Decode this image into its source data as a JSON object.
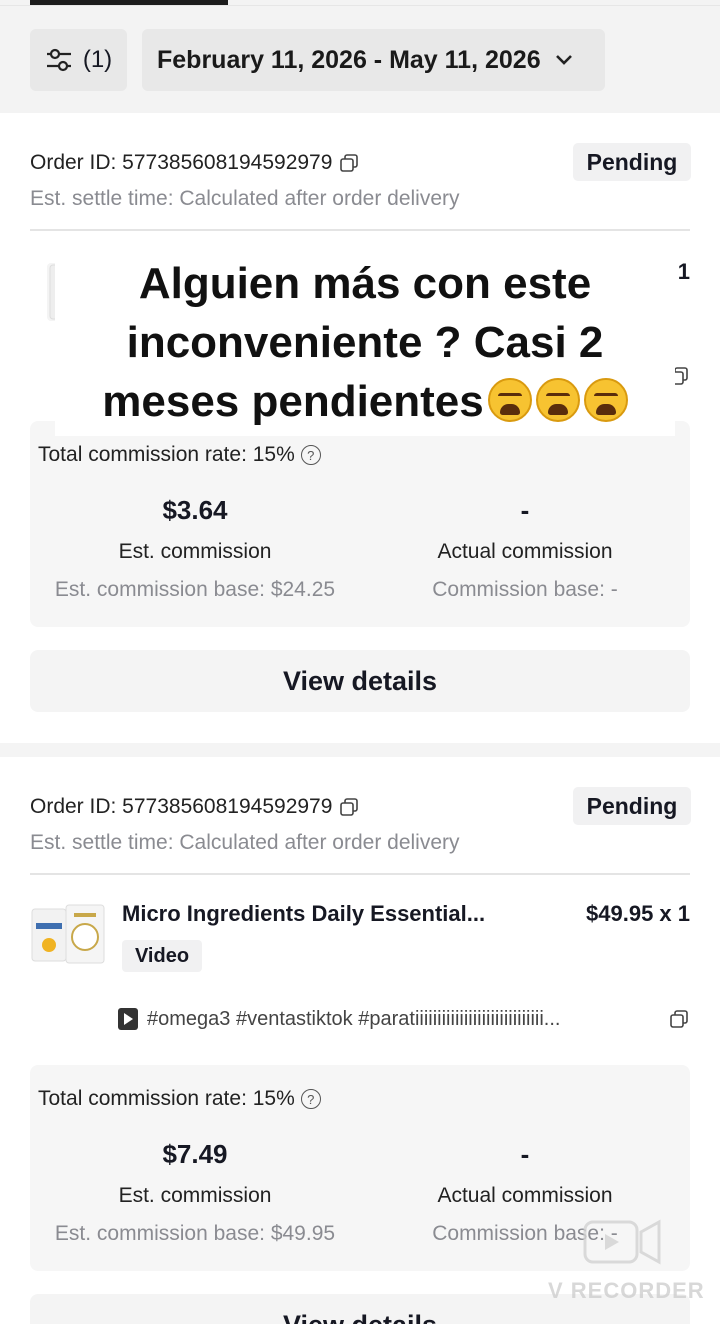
{
  "header": {
    "filter_label": "(1)",
    "date_range": "February 11, 2026 - May 11, 2026"
  },
  "orders": [
    {
      "order_id": "Order ID: 577385608194592979",
      "settle_time": "Est. settle time: Calculated after order delivery",
      "status": "Pending",
      "price_partial": "5 x 1",
      "commission_rate": "Total commission rate: 15%",
      "est_commission": "$3.64",
      "est_commission_label": "Est. commission",
      "est_base": "Est. commission base: $24.25",
      "actual_commission": "-",
      "actual_commission_label": "Actual commission",
      "actual_base": "Commission base: -",
      "view_details": "View details"
    },
    {
      "order_id": "Order ID: 577385608194592979",
      "settle_time": "Est. settle time: Calculated after order delivery",
      "status": "Pending",
      "product_name": "Micro Ingredients Daily Essential...",
      "price": "$49.95 x 1",
      "tag": "Video",
      "hashtags": "#omega3 #ventastiktok #paratiiiiiiiiiiiiiiiiiiiiiiiiiiiii...",
      "commission_rate": "Total commission rate: 15%",
      "est_commission": "$7.49",
      "est_commission_label": "Est. commission",
      "est_base": "Est. commission base: $49.95",
      "actual_commission": "-",
      "actual_commission_label": "Actual commission",
      "actual_base": "Commission base: -",
      "view_details": "View details"
    }
  ],
  "overlay": {
    "line1": "Alguien más con este",
    "line2": "inconveniente ? Casi 2",
    "line3": "meses pendientes"
  },
  "watermark": "V RECORDER",
  "icons": {
    "filter": "sliders-icon",
    "chevron": "chevron-down-icon",
    "copy": "copy-icon",
    "help": "question-circle-icon",
    "video": "video-play-icon",
    "emoji": "weary-face-emoji"
  }
}
